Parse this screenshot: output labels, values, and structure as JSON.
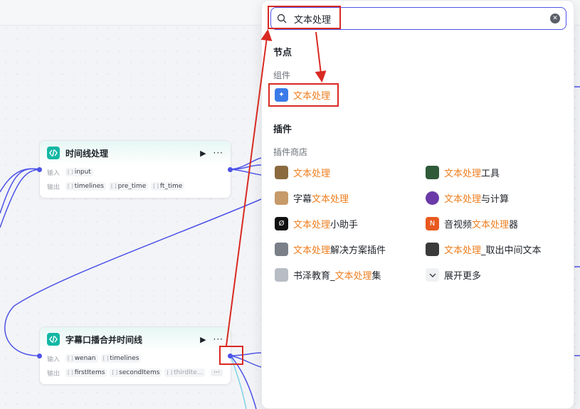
{
  "node1": {
    "title": "时间线处理",
    "input_label": "输入",
    "output_label": "输出",
    "inputs": [
      "input"
    ],
    "outputs": [
      "timelines",
      "pre_time",
      "ft_time"
    ]
  },
  "node2": {
    "title": "字幕口播合并时间线",
    "input_label": "输入",
    "output_label": "输出",
    "inputs": [
      "wenan",
      "timelines"
    ],
    "outputs": [
      "firstItems",
      "secondItems",
      "thirdIte..."
    ],
    "more": "···"
  },
  "tag_type": "[ ]",
  "node_more": "···",
  "search": {
    "value": "文本处理"
  },
  "panel": {
    "nodes_header": "节点",
    "components_header": "组件",
    "component_item": "文本处理",
    "plugins_header": "插件",
    "plugin_store_header": "插件商店",
    "plugins": [
      {
        "pre": "",
        "hl": "文本处理",
        "post": "",
        "icon": "doc-plugin-icon",
        "color": "#8a6a3e"
      },
      {
        "pre": "",
        "hl": "文本处理",
        "post": "工具",
        "icon": "text-tool-icon",
        "color": "#2f5a3a"
      },
      {
        "pre": "字幕",
        "hl": "文本处理",
        "post": "",
        "icon": "avatar-icon",
        "color": "#c79a6a"
      },
      {
        "pre": "",
        "hl": "文本处理",
        "post": "与计算",
        "icon": "calc-icon",
        "color": "#6a3aa8"
      },
      {
        "pre": "",
        "hl": "文本处理",
        "post": "小助手",
        "icon": "assistant-icon",
        "color": "#111111"
      },
      {
        "pre": "音视频",
        "hl": "文本处理",
        "post": "器",
        "icon": "media-icon",
        "color": "#e8591f"
      },
      {
        "pre": "",
        "hl": "文本处理",
        "post": "解决方案插件",
        "icon": "monitor-icon",
        "color": "#7a7f88"
      },
      {
        "pre": "",
        "hl": "文本处理",
        "post": "_取出中间文本",
        "icon": "texture-icon",
        "color": "#3a3a3a"
      },
      {
        "pre": "书泽教育_",
        "hl": "文本处理",
        "post": "集",
        "icon": "edu-icon",
        "color": "#b8bcc4"
      },
      {
        "pre": "展开更多",
        "hl": "",
        "post": "",
        "icon": "chevron-down-icon",
        "color": "#ffffff"
      }
    ]
  },
  "colors": {
    "accent": "#4d53e8",
    "highlight": "#ee7e1f",
    "annotation": "#d82a22",
    "node_icon": "#13b7a4"
  }
}
